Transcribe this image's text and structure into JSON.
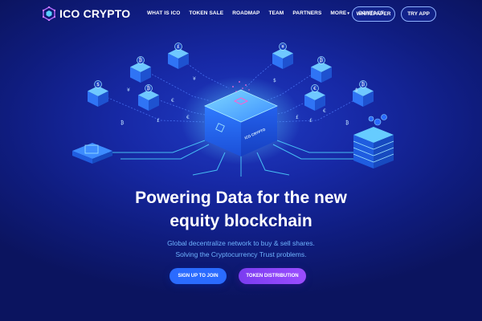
{
  "logo": {
    "prefix": "ICO",
    "suffix": " CRYPTO"
  },
  "nav": {
    "items": [
      {
        "label": "WHAT IS ICO"
      },
      {
        "label": "TOKEN SALE"
      },
      {
        "label": "ROADMAP"
      },
      {
        "label": "TEAM"
      },
      {
        "label": "PARTNERS"
      },
      {
        "label": "MORE"
      },
      {
        "label": "CONTACT"
      }
    ],
    "more_caret": "▾",
    "whitepaper_label": "WHITEPAPER",
    "try_app_label": "TRY APP"
  },
  "illustration": {
    "center_cube_label": "ICO CRYPTO",
    "currency_symbols": [
      "$",
      "₿",
      "£",
      "₿",
      "¥",
      "₿",
      "€",
      "₿",
      "₿",
      "£",
      "¥",
      "€",
      "$",
      "£",
      "€",
      "₿",
      "€",
      "£",
      "¥",
      "$"
    ]
  },
  "hero": {
    "title_line1": "Powering Data for the new",
    "title_line2": "equity blockchain",
    "subtitle_line1": "Global decentralize network to buy & sell shares.",
    "subtitle_line2": "Solving the Cryptocurrency Trust problems."
  },
  "cta": {
    "signup_label": "SIGN UP TO JOIN",
    "token_label": "TOKEN DISTRIBUTION"
  },
  "colors": {
    "background": "#1729a6",
    "accent_blue": "#2a6bff",
    "accent_purple": "#8a44f8",
    "subtitle": "#6fb4ff",
    "cube_glow": "#4fc3ff"
  }
}
